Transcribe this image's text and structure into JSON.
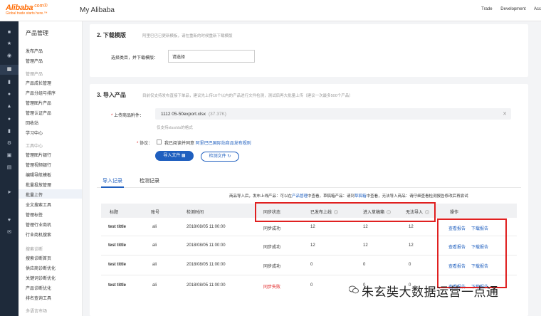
{
  "header": {
    "logo_main": "Alibaba",
    "logo_com": ".com®",
    "logo_sub": "Global trade starts here.™",
    "title": "My Alibaba",
    "nav": [
      "Trade",
      "Development",
      "Acc"
    ]
  },
  "sidebar": {
    "title": "产品管理",
    "items": [
      {
        "label": "发布产品",
        "type": "item"
      },
      {
        "label": "管理产品",
        "type": "item"
      },
      {
        "label": "管理产品",
        "type": "group"
      },
      {
        "label": "产品成长管理",
        "type": "item"
      },
      {
        "label": "产品分组与排序",
        "type": "item"
      },
      {
        "label": "管理图片产品",
        "type": "item"
      },
      {
        "label": "管理认证产品",
        "type": "item"
      },
      {
        "label": "回收站",
        "type": "item"
      },
      {
        "label": "学习中心",
        "type": "item"
      },
      {
        "label": "工具中心",
        "type": "group"
      },
      {
        "label": "管理图片银行",
        "type": "item"
      },
      {
        "label": "管理视频银行",
        "type": "item"
      },
      {
        "label": "编辑导航模板",
        "type": "item"
      },
      {
        "label": "批量投放管理",
        "type": "item"
      },
      {
        "label": "批量上传",
        "type": "item",
        "active": true
      },
      {
        "label": "全文搜索工具",
        "type": "item"
      },
      {
        "label": "管理标签",
        "type": "item"
      },
      {
        "label": "管理行业商机",
        "type": "item"
      },
      {
        "label": "行业商机搜索",
        "type": "item"
      },
      {
        "label": "搜索诊断",
        "type": "group"
      },
      {
        "label": "搜索诊断首页",
        "type": "item"
      },
      {
        "label": "供应商诊断优化",
        "type": "item"
      },
      {
        "label": "关键词诊断优化",
        "type": "item"
      },
      {
        "label": "产品诊断优化",
        "type": "item"
      },
      {
        "label": "排名查询工具",
        "type": "item"
      },
      {
        "label": "多语言市场",
        "type": "group"
      }
    ]
  },
  "section2": {
    "title": "2. 下载模版",
    "desc": "阿里巴巴已更新模板，请在重新的时候重新下载模版",
    "label": "选择类目，并下载模版：",
    "select_value": "请选择"
  },
  "section3": {
    "title": "3. 导入产品",
    "desc": "目前仅支持发布直接下单品，建议先上传10个以内的产品进行文件检测，测试后再大批量上传（建议一次最多500个产品）",
    "file_label": "上传商品附件：",
    "file_name": "1112 05-50export.xlsx",
    "file_size": "(37.37K)",
    "file_hint": "仅支持xlsx/xls的格式",
    "agree_label": "协议：",
    "agree_text": "我已阅读并同意",
    "agree_link": "阿里巴巴国际站商品发布规则",
    "import_btn": "导入文件",
    "check_btn": "检测文件"
  },
  "tabs": [
    {
      "label": "导入记录",
      "active": true
    },
    {
      "label": "检测记录",
      "active": false
    }
  ],
  "notice": {
    "prefix": "商品导入后，发布上线产品：可以在",
    "link1": "产品管理",
    "mid1": "中查看，草稿箱产品：请到",
    "link2": "草稿箱",
    "mid2": "中查看，无法导入商品：请仔细查看检测报告修改后再尝试"
  },
  "table": {
    "headers": [
      "标题",
      "账号",
      "检测时间",
      "同步状态",
      "已发布上线",
      "进入草稿箱",
      "无法导入",
      "操作"
    ],
    "rows": [
      {
        "title": "test tittle",
        "account": "ali",
        "time": "2018/08/05 11:00:00",
        "status": "同步成功",
        "status_ok": true,
        "published": "12",
        "draft": "12",
        "failed": "12",
        "op1": "查看报告",
        "op2": "下载报告"
      },
      {
        "title": "test tittle",
        "account": "ali",
        "time": "2018/08/05 11:00:00",
        "status": "同步成功",
        "status_ok": true,
        "published": "12",
        "draft": "12",
        "failed": "12",
        "op1": "查看报告",
        "op2": "下载报告"
      },
      {
        "title": "test tittle",
        "account": "ali",
        "time": "2018/08/05 11:00:00",
        "status": "同步成功",
        "status_ok": true,
        "published": "0",
        "draft": "0",
        "failed": "0",
        "op1": "查看报告",
        "op2": "下载报告"
      },
      {
        "title": "test tittle",
        "account": "ali",
        "time": "2018/08/05 11:00:00",
        "status": "同步失败",
        "status_ok": false,
        "published": "0",
        "draft": "0",
        "failed": "0",
        "op1": "查看报告",
        "op2": "下载报告"
      }
    ]
  },
  "watermark": "朱玄奘大数据运营一点通",
  "colors": {
    "brand": "#ff6a00",
    "link": "#1f5fbf",
    "fail": "#e02020",
    "sidebar_dark": "#1e2a3a"
  }
}
